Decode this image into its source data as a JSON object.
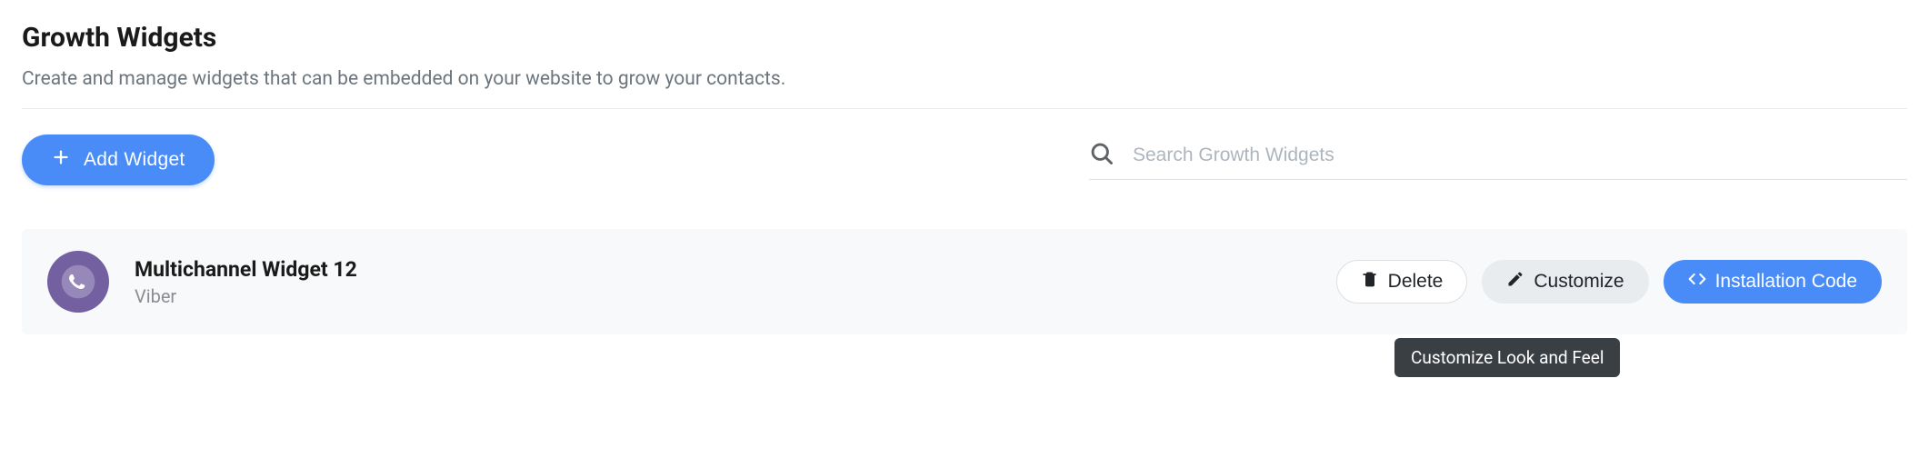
{
  "header": {
    "title": "Growth Widgets",
    "description": "Create and manage widgets that can be embedded on your website to grow your contacts."
  },
  "actions": {
    "add_label": "Add Widget"
  },
  "search": {
    "placeholder": "Search Growth Widgets",
    "value": ""
  },
  "widgets": [
    {
      "name": "Multichannel Widget 12",
      "channel": "Viber",
      "icon": "viber"
    }
  ],
  "row_actions": {
    "delete_label": "Delete",
    "customize_label": "Customize",
    "install_label": "Installation Code"
  },
  "tooltip": {
    "customize": "Customize Look and Feel"
  },
  "colors": {
    "primary": "#4a8cf7",
    "viber": "#7360a1",
    "row_bg": "#f8f9fa"
  }
}
